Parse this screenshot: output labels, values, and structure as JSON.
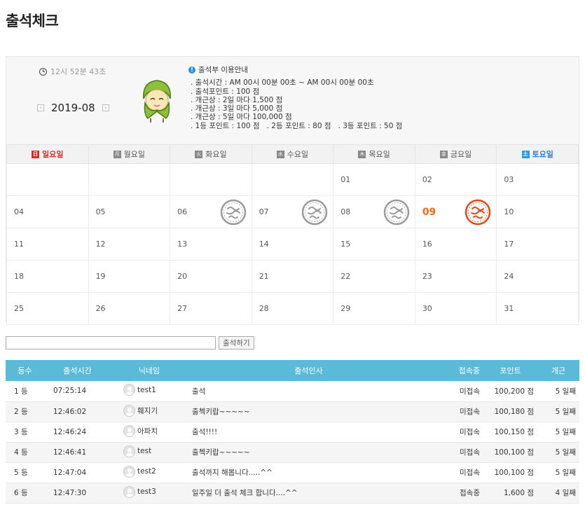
{
  "page": {
    "title": "출석체크"
  },
  "clock": {
    "text": "12시 52분 43초"
  },
  "month": {
    "label": "2019-08",
    "prev_label": "‹",
    "next_label": "›"
  },
  "notice": {
    "title": "출석부 이용안내",
    "lines": [
      ". 출석시간 : AM 00시 00분 00초 ~ AM 00시 00분 00초",
      ". 출석포인트 : 100 점",
      ". 개근상 : 2일 마다 1,500 점",
      ". 개근상 : 3일 마다 5,000 점",
      ". 개근상 : 5일 마다 100,000 점",
      ". 1등 포인트 : 100 점   . 2등 포인트 : 80 점   . 3등 포인트 : 50 점"
    ]
  },
  "calendar": {
    "weekdays": [
      {
        "badge": "日",
        "label": "일요일"
      },
      {
        "badge": "月",
        "label": "월요일"
      },
      {
        "badge": "火",
        "label": "화요일"
      },
      {
        "badge": "水",
        "label": "수요일"
      },
      {
        "badge": "木",
        "label": "목요일"
      },
      {
        "badge": "金",
        "label": "금요일"
      },
      {
        "badge": "土",
        "label": "토요일"
      }
    ],
    "weeks": [
      [
        "",
        "",
        "",
        "",
        "01",
        "02",
        "03"
      ],
      [
        "04",
        "05",
        "06",
        "07",
        "08",
        "09",
        "10"
      ],
      [
        "11",
        "12",
        "13",
        "14",
        "15",
        "16",
        "17"
      ],
      [
        "18",
        "19",
        "20",
        "21",
        "22",
        "23",
        "24"
      ],
      [
        "25",
        "26",
        "27",
        "28",
        "29",
        "30",
        "31"
      ]
    ],
    "attended_days": [
      "06",
      "07",
      "08"
    ],
    "today": "09",
    "colors": {
      "sunday": "#d92a2a",
      "saturday": "#2a7ad9",
      "today": "#f06a1a",
      "stamp_gray": "#9a9a9a",
      "stamp_today": "#e0481a"
    }
  },
  "greeting_form": {
    "input_value": "",
    "button_label": "출석하기"
  },
  "ranking": {
    "header_color": "#5bbad8",
    "columns": [
      "등수",
      "출석시간",
      "닉네임",
      "출석인사",
      "접속중",
      "포인트",
      "개근"
    ],
    "rows": [
      {
        "rank": "1 등",
        "time": "07:25:14",
        "nick": "test1",
        "message": "출석",
        "status": "미접속",
        "point": "100,200 점",
        "streak": "5 일째"
      },
      {
        "rank": "2 등",
        "time": "12:46:02",
        "nick": "훼지기",
        "message": "출첵키랍~~~~~",
        "status": "미접속",
        "point": "100,180 점",
        "streak": "5 일째"
      },
      {
        "rank": "3 등",
        "time": "12:46:24",
        "nick": "아파치",
        "message": "출석!!!!",
        "status": "미접속",
        "point": "100,150 점",
        "streak": "5 일째"
      },
      {
        "rank": "4 등",
        "time": "12:46:41",
        "nick": "test",
        "message": "출첵키랍~~~~~",
        "status": "미접속",
        "point": "100,100 점",
        "streak": "5 일째"
      },
      {
        "rank": "5 등",
        "time": "12:47:04",
        "nick": "test2",
        "message": "출석까지 해봅니다.....^^",
        "status": "미접속",
        "point": "100,100 점",
        "streak": "5 일째"
      },
      {
        "rank": "6 등",
        "time": "12:47:30",
        "nick": "test3",
        "message": "일주일 더 출석 체크 합니다....^^",
        "status": "접속중",
        "point": "1,600 점",
        "streak": "4 일째"
      }
    ]
  }
}
